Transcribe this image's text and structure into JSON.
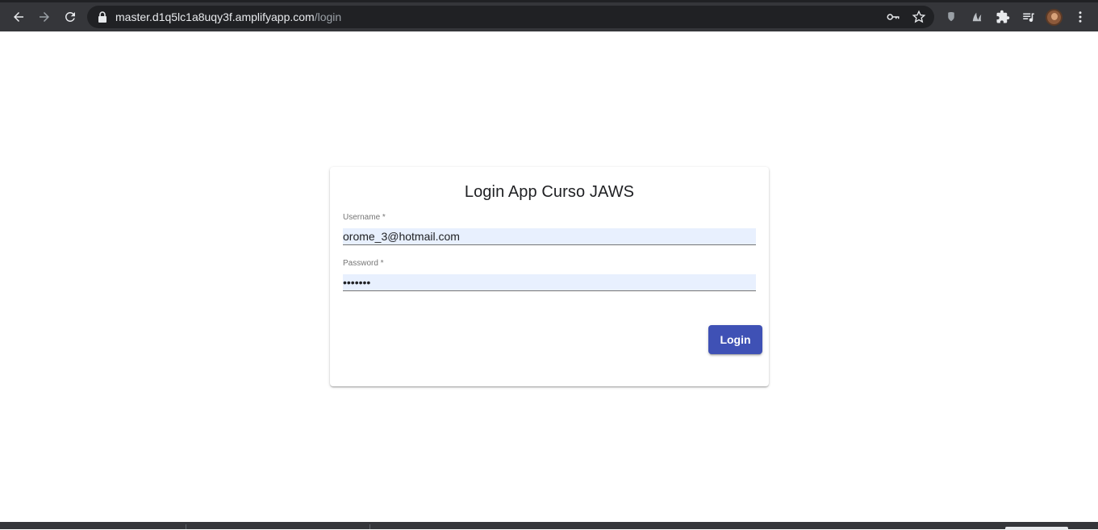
{
  "browser": {
    "url_host": "master.d1q5lc1a8uqy3f.amplifyapp.com",
    "url_path": "/login",
    "icons": [
      "back-arrow-icon",
      "forward-arrow-icon",
      "reload-icon",
      "lock-icon",
      "key-icon",
      "star-icon",
      "extension-shield-icon",
      "extension-leaf-icon",
      "puzzle-icon",
      "media-queue-icon",
      "profile-avatar",
      "kebab-menu-icon"
    ]
  },
  "login": {
    "title": "Login App Curso JAWS",
    "username_label": "Username *",
    "username_value": "orome_3@hotmail.com",
    "password_label": "Password *",
    "password_value": "•••••••",
    "button_label": "Login"
  },
  "colors": {
    "toolbar": "#35363a",
    "omnibox": "#202124",
    "primary": "#3f51b5",
    "autofill": "#e8f0fe"
  }
}
